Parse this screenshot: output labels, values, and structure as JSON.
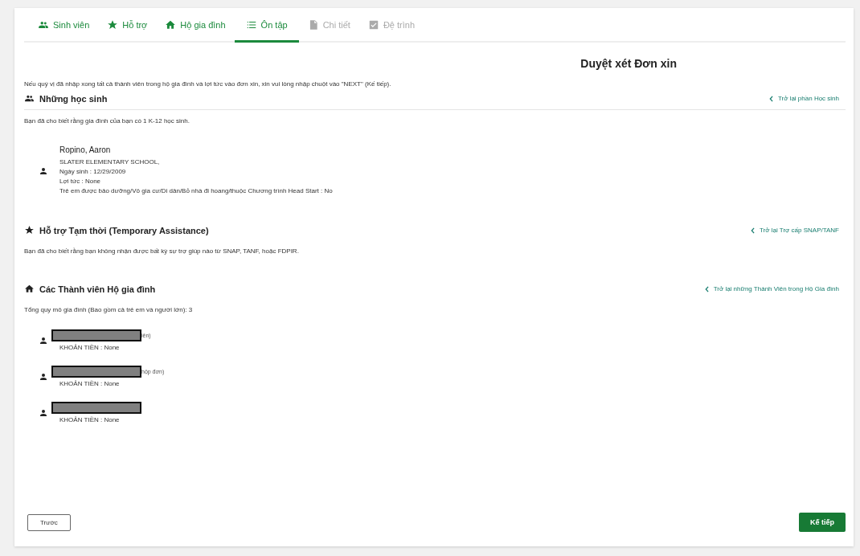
{
  "tabs": [
    {
      "label": "Sinh viên",
      "kind": "people",
      "selected": false,
      "disabled": false
    },
    {
      "label": "Hỗ trợ",
      "kind": "star",
      "selected": false,
      "disabled": false
    },
    {
      "label": "Hộ gia đình",
      "kind": "home",
      "selected": false,
      "disabled": false
    },
    {
      "label": "Ôn tập",
      "kind": "list",
      "selected": true,
      "disabled": false
    },
    {
      "label": "Chi tiết",
      "kind": "doc",
      "selected": false,
      "disabled": true
    },
    {
      "label": "Đệ trình",
      "kind": "check",
      "selected": false,
      "disabled": true
    }
  ],
  "title": "Duyệt xét Đơn xin",
  "intro": "Nếu quý vị đã nhập xong tất cả thành viên trong hộ gia đình và lợi tức vào đơn xin, xin vui lòng nhập chuột vào \"NEXT\" (Kế tiếp).",
  "students": {
    "heading": "Những học sinh",
    "back_link": "Trở lại phần Học sinh",
    "text": "Bạn đã cho biết rằng gia đình của bạn có 1 K-12 học sinh.",
    "items": [
      {
        "name": "Ropino, Aaron",
        "lines": [
          "SLATER ELEMENTARY SCHOOL,",
          "Ngày sinh : 12/29/2009",
          "Lợi tức : None",
          "Trẻ em được bảo dưỡng/Vô gia cư/Di dân/Bỏ nhà đi hoang/thuộc Chương trình Head Start : No"
        ]
      }
    ]
  },
  "assistance": {
    "heading": "Hỗ trợ Tạm thời (Temporary Assistance)",
    "back_link": "Trở lại Trợ cấp SNAP/TANF",
    "text": "Bạn đã cho biết rằng bạn không nhận được bất kỳ sự trợ giúp nào từ SNAP, TANF, hoặc FDPIR."
  },
  "household": {
    "heading": "Các Thành viên Hộ gia đình",
    "back_link": "Trở lại những Thành Viên trong Hộ Gia đình",
    "text": "Tổng quy mô gia đình (Bao gồm cả trẻ em và người lớn): 3",
    "members": [
      {
        "name_tail": "iên)",
        "income": "KHOẢN TIỀN : None"
      },
      {
        "name_tail": "hộp đơn)",
        "income": "KHOẢN TIỀN : None"
      },
      {
        "income": "KHOẢN TIỀN : None"
      }
    ]
  },
  "buttons": {
    "back": "Trước",
    "next": "Kế tiếp"
  }
}
